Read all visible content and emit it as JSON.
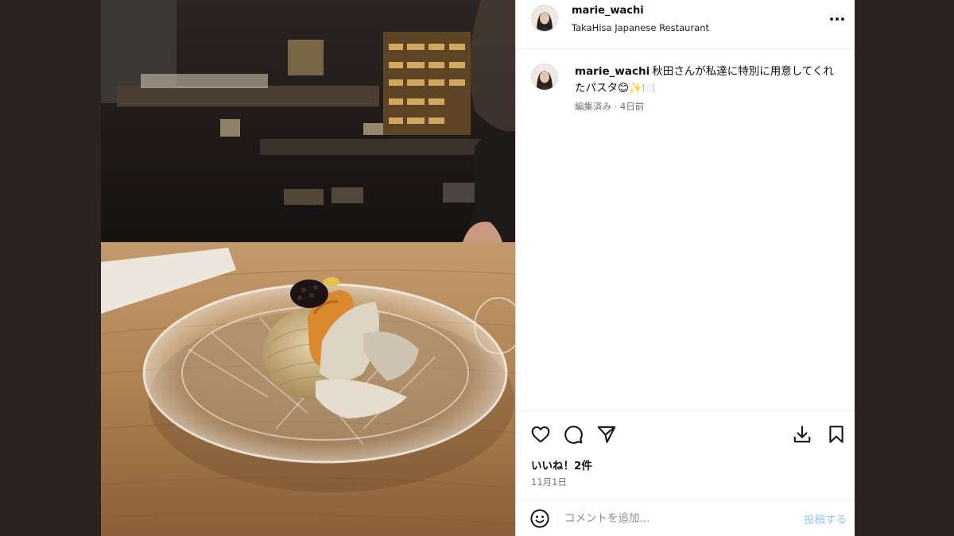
{
  "post": {
    "username": "marie_wachi",
    "location": "TakaHisa Japanese Restaurant"
  },
  "caption": {
    "username": "marie_wachi",
    "text": "秋田さんが私達に特別に用意してくれたパスタ",
    "emojis": "😊✨🍽️",
    "meta": "編集済み · 4日前"
  },
  "actions": {
    "like_icon": "heart-icon",
    "comment_icon": "comment-icon",
    "share_icon": "send-icon",
    "save_icon": "bookmark-icon",
    "download_icon": "download-icon"
  },
  "likes": "いいね！2件",
  "date": "11月1日",
  "comment_box": {
    "placeholder": "コメントを追加...",
    "post_label": "投稿する",
    "emoji_icon": "smiley-icon"
  },
  "colors": {
    "post_button_disabled": "#9bc3e8",
    "meta_text": "#737373",
    "background": "#2a2322"
  }
}
